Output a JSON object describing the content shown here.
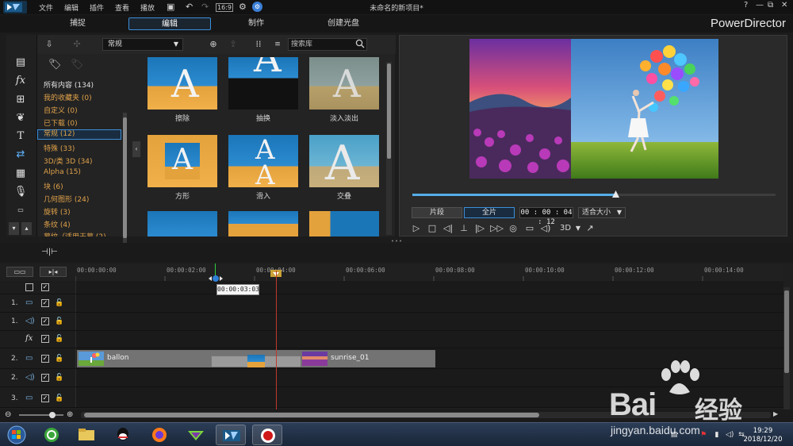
{
  "titlebar": {
    "menus": [
      "文件",
      "编辑",
      "插件",
      "查看",
      "播放"
    ],
    "title": "未命名的新项目*",
    "window_buttons": [
      "?",
      "—",
      "⧉",
      "✕"
    ]
  },
  "modes": {
    "tabs": [
      "捕捉",
      "编辑",
      "制作",
      "创建光盘"
    ],
    "active": "编辑",
    "brand": "PowerDirector"
  },
  "library": {
    "dropdown_value": "常规",
    "search_placeholder": "搜索库",
    "categories": [
      {
        "label": "所有内容 (134)",
        "color": "white"
      },
      {
        "label": "我的收藏夹 (0)",
        "color": "orange"
      },
      {
        "label": "自定义 (0)",
        "color": "orange"
      },
      {
        "label": "已下载 (0)",
        "color": "orange"
      },
      {
        "label": "常规 (12)",
        "color": "orange",
        "selected": true
      },
      {
        "label": "特殊 (33)",
        "color": "orange"
      },
      {
        "label": "3D/类 3D (34)",
        "color": "orange"
      },
      {
        "label": "Alpha (15)",
        "color": "orange"
      },
      {
        "label": "块 (6)",
        "color": "orange"
      },
      {
        "label": "几何图形 (24)",
        "color": "orange"
      },
      {
        "label": "旋转 (3)",
        "color": "orange"
      },
      {
        "label": "条纹 (4)",
        "color": "orange"
      },
      {
        "label": "幕纹（适用于幕 (2)",
        "color": "orange"
      }
    ],
    "transitions": [
      {
        "label": "擦除"
      },
      {
        "label": "抽换"
      },
      {
        "label": "淡入淡出"
      },
      {
        "label": "方形"
      },
      {
        "label": "滑入"
      },
      {
        "label": "交叠"
      }
    ]
  },
  "preview": {
    "position_fraction": 0.56,
    "mode_clip": "片段",
    "mode_movie": "全片",
    "active_mode": "全片",
    "timecode": "00 : 00 : 04 : 12",
    "fit": "适合大小",
    "three_d": "3D"
  },
  "timeline": {
    "ruler": [
      "00:00:00:00",
      "00:00:02:00",
      "00:00:04:00",
      "00:00:06:00",
      "00:00:08:00",
      "00:00:10:00",
      "00:00:12:00",
      "00:00:14:00"
    ],
    "tooltip": "00:00:03:03",
    "tracks": [
      {
        "num": "",
        "type": "master"
      },
      {
        "num": "1.",
        "type": "video"
      },
      {
        "num": "1.",
        "type": "audio"
      },
      {
        "num": "",
        "type": "fx"
      },
      {
        "num": "2.",
        "type": "video"
      },
      {
        "num": "2.",
        "type": "audio"
      },
      {
        "num": "3.",
        "type": "video"
      }
    ],
    "clips": [
      {
        "name": "ballon"
      },
      {
        "name": "sunrise_01"
      }
    ]
  },
  "taskbar": {
    "time": "19:29",
    "date": "2018/12/20"
  },
  "watermark": {
    "brand_latin": "Bai",
    "brand_cn": "经验",
    "url": "jingyan.baidu.com"
  },
  "colors": {
    "accent": "#3b8ed8",
    "category_orange": "#e0a24a",
    "playhead": "#c0392b"
  }
}
